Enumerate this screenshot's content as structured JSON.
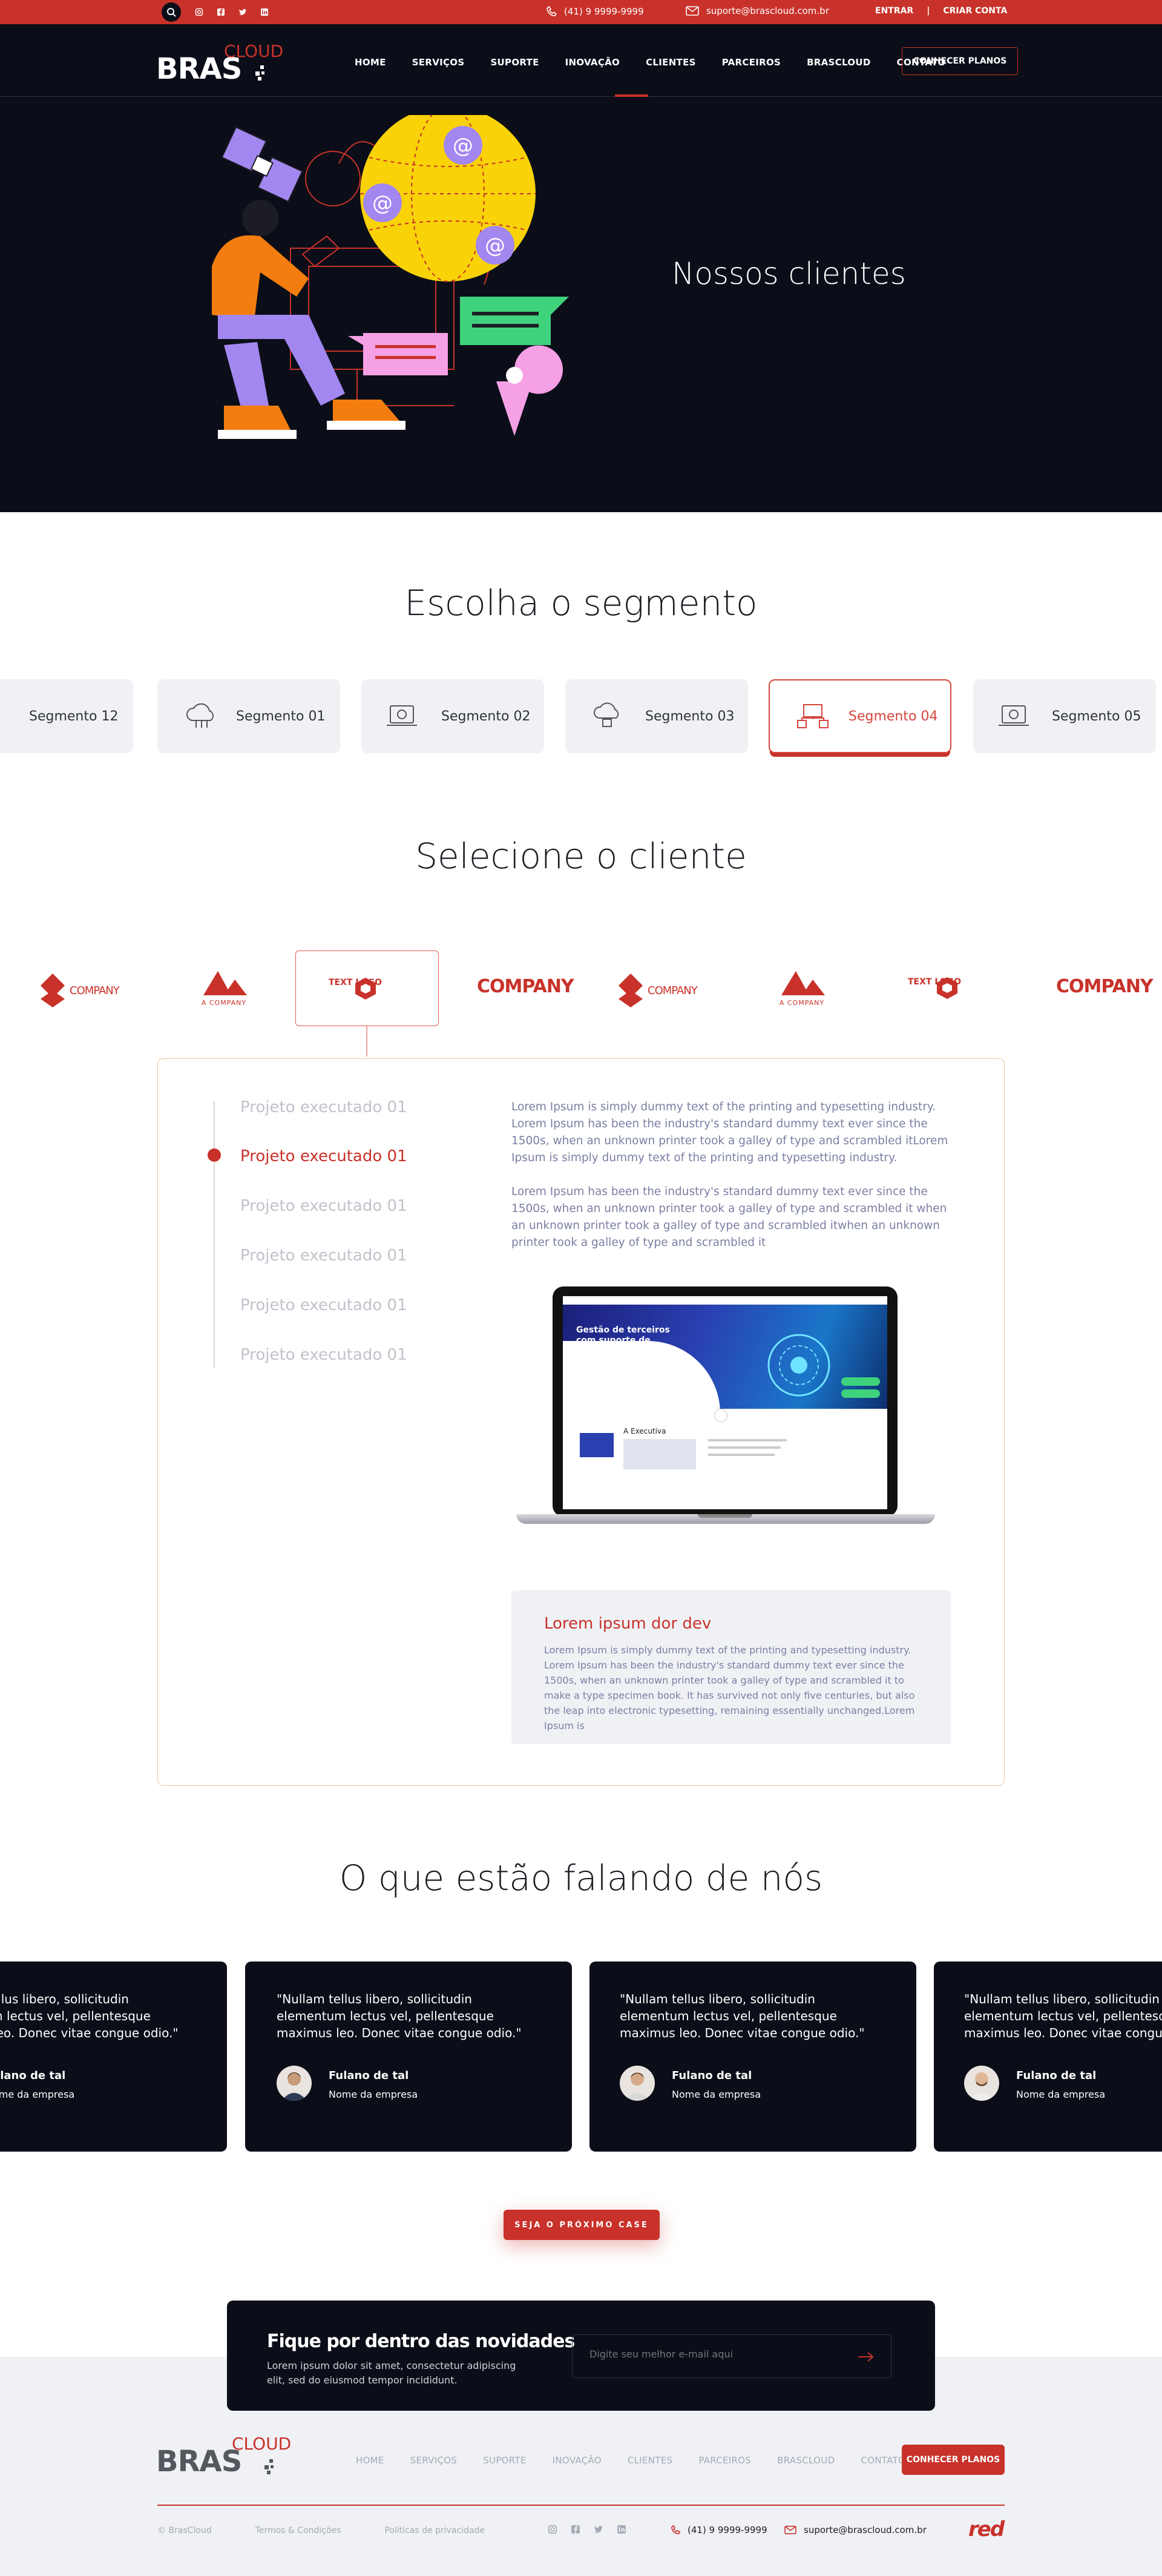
{
  "topbar": {
    "phone": "(41) 9 9999-9999",
    "email": "suporte@brascloud.com.br",
    "login": "ENTRAR",
    "separator": "|",
    "signup": "CRIAR CONTA",
    "social": [
      "instagram-icon",
      "facebook-icon",
      "twitter-icon",
      "linkedin-icon"
    ]
  },
  "brand": {
    "name": "BRAS",
    "suffix": "CLOUD"
  },
  "nav": {
    "items": [
      "HOME",
      "SERVIÇOS",
      "SUPORTE",
      "INOVAÇÃO",
      "CLIENTES",
      "PARCEIROS",
      "BRASCLOUD",
      "CONTATO"
    ],
    "active_index": 4,
    "cta": "CONHECER PLANOS"
  },
  "hero": {
    "title": "Nossos clientes"
  },
  "segments": {
    "title": "Escolha o segmento",
    "items": [
      "Segmento 12",
      "Segmento 01",
      "Segmento 02",
      "Segmento 03",
      "Segmento 04",
      "Segmento 05"
    ],
    "active_index": 4
  },
  "clients": {
    "title": "Selecione o cliente",
    "logos": [
      "COMPANY",
      "A COMPANY",
      "TEXT LOGO",
      "COMPANY",
      "COMPANY",
      "A COMPANY",
      "TEXT LOGO",
      "COMPANY"
    ],
    "active_index": 2
  },
  "project": {
    "items": [
      "Projeto executado 01",
      "Projeto executado 01",
      "Projeto executado 01",
      "Projeto executado 01",
      "Projeto executado 01",
      "Projeto executado 01"
    ],
    "active_index": 1,
    "paragraph1": "Lorem Ipsum is simply dummy text of the printing and typesetting industry. Lorem Ipsum has been the industry's standard dummy text ever since the 1500s, when an unknown printer took a galley of type and scrambled itLorem Ipsum is simply dummy text of the printing and typesetting industry.",
    "paragraph2": "Lorem Ipsum has been the industry's standard dummy text ever since the 1500s, when an unknown printer took a galley of type and scrambled it when an unknown printer took a galley of type and scrambled itwhen an unknown printer took a galley of type and scrambled it",
    "laptop_headline": "Gestão de terceiros com suporte de exelência",
    "laptop_section": "A Executiva",
    "box_title": "Lorem ipsum dor dev",
    "box_text": "Lorem Ipsum is simply dummy text of the printing and typesetting industry. Lorem Ipsum has been the industry's standard dummy text ever since the 1500s, when an unknown printer took a galley of type and scrambled it to make a type specimen book. It has survived not only five centuries, but also the leap into electronic typesetting, remaining essentially unchanged.Lorem Ipsum is"
  },
  "testimonials": {
    "title": "O que estão falando de nós",
    "items": [
      {
        "quote": "\"Nullam tellus libero, sollicitudin elementum lectus vel, pellentesque maximus leo. Donec vitae congue odio.\"",
        "name": "Fulano de tal",
        "company": "Nome da empresa"
      },
      {
        "quote": "\"Nullam tellus libero, sollicitudin elementum lectus vel, pellentesque maximus leo. Donec vitae congue odio.\"",
        "name": "Fulano de tal",
        "company": "Nome da empresa"
      },
      {
        "quote": "\"Nullam tellus libero, sollicitudin elementum lectus vel, pellentesque maximus leo. Donec vitae congue odio.\"",
        "name": "Fulano de tal",
        "company": "Nome da empresa"
      },
      {
        "quote": "\"Nullam tellus libero, sollicitudin elementum lectus vel, pellentesque maximus leo. Donec vitae congue odio.\"",
        "name": "Fulano de tal",
        "company": "Nome da empresa"
      }
    ],
    "cta": "SEJA O PRÓXIMO CASE"
  },
  "newsletter": {
    "title": "Fique por dentro das novidades",
    "subtitle": "Lorem ipsum dolor sit amet, consectetur adipiscing elit, sed do eiusmod tempor incididunt.",
    "placeholder": "Digite seu melhor e-mail aqui"
  },
  "footer": {
    "nav": [
      "HOME",
      "SERVIÇOS",
      "SUPORTE",
      "INOVAÇÃO",
      "CLIENTES",
      "PARCEIROS",
      "BRASCLOUD",
      "CONTATO"
    ],
    "cta": "CONHECER PLANOS",
    "copyright": "© BrasCloud",
    "terms": "Termos & Condições",
    "privacy": "Políticas de privacidade",
    "phone": "(41) 9 9999-9999",
    "email": "suporte@brascloud.com.br",
    "agency": "red"
  },
  "colors": {
    "accent": "#c8322a",
    "dark": "#0b0e18",
    "light_bg": "#f0f1f5",
    "panel_border": "#f2c39b"
  }
}
